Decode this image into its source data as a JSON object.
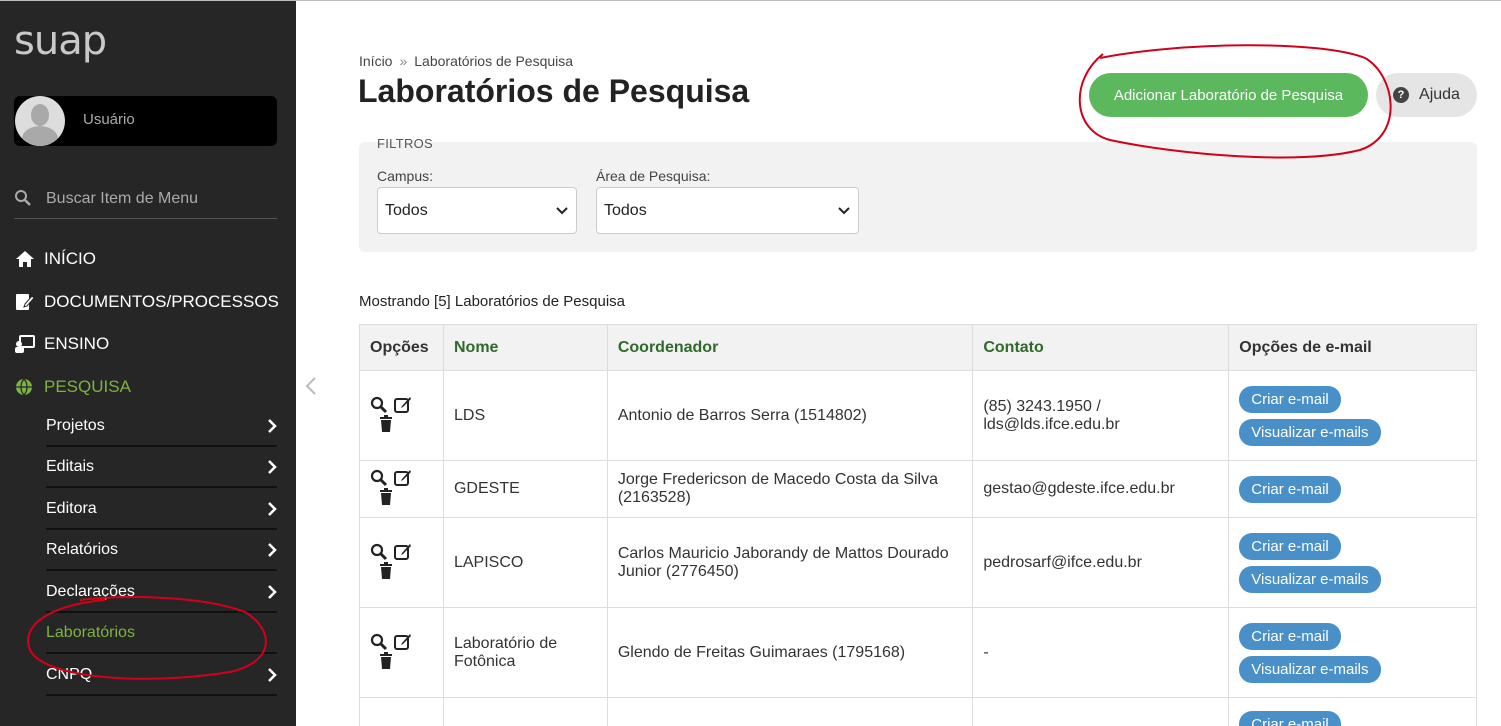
{
  "sidebar": {
    "logo": "suap",
    "user": "Usuário",
    "search_placeholder": "Buscar Item de Menu",
    "nav": [
      {
        "label": "INÍCIO"
      },
      {
        "label": "DOCUMENTOS/PROCESSOS"
      },
      {
        "label": "ENSINO"
      },
      {
        "label": "PESQUISA"
      }
    ],
    "sub": [
      {
        "label": "Projetos"
      },
      {
        "label": "Editais"
      },
      {
        "label": "Editora"
      },
      {
        "label": "Relatórios"
      },
      {
        "label": "Declarações"
      },
      {
        "label": "Laboratórios"
      },
      {
        "label": "CNPQ"
      }
    ]
  },
  "breadcrumb": {
    "home": "Início",
    "sep": "»",
    "current": "Laboratórios de Pesquisa"
  },
  "page_title": "Laboratórios de Pesquisa",
  "actions": {
    "add": "Adicionar Laboratório de Pesquisa",
    "help": "Ajuda",
    "help_icon": "?"
  },
  "filters": {
    "title": "FILTROS",
    "campus_label": "Campus:",
    "campus_value": "Todos",
    "area_label": "Área de Pesquisa:",
    "area_value": "Todos"
  },
  "count_text": "Mostrando [5] Laboratórios de Pesquisa",
  "table": {
    "headers": [
      "Opções",
      "Nome",
      "Coordenador",
      "Contato",
      "Opções de e-mail"
    ],
    "rows": [
      {
        "nome": "LDS",
        "coordenador": "Antonio de Barros Serra (1514802)",
        "contato": "(85) 3243.1950 / lds@lds.ifce.edu.br",
        "criar": "Criar e-mail",
        "visualizar": "Visualizar e-mails"
      },
      {
        "nome": "GDESTE",
        "coordenador": "Jorge Fredericson de Macedo Costa da Silva (2163528)",
        "contato": "gestao@gdeste.ifce.edu.br",
        "criar": "Criar e-mail"
      },
      {
        "nome": "LAPISCO",
        "coordenador": "Carlos Mauricio Jaborandy de Mattos Dourado Junior (2776450)",
        "contato": "pedrosarf@ifce.edu.br",
        "criar": "Criar e-mail",
        "visualizar": "Visualizar e-mails"
      },
      {
        "nome": "Laboratório de Fotônica",
        "coordenador": "Glendo de Freitas Guimaraes (1795168)",
        "contato": "-",
        "criar": "Criar e-mail",
        "visualizar": "Visualizar e-mails"
      },
      {
        "nome": "",
        "coordenador": "",
        "contato": "",
        "criar": "Criar e-mail"
      }
    ]
  },
  "colors": {
    "sidebar": "#262626",
    "accent_green": "#7cb342",
    "button_green": "#5cb85c",
    "pill_blue": "#4a90c8",
    "annotation_red": "#d0021b"
  }
}
